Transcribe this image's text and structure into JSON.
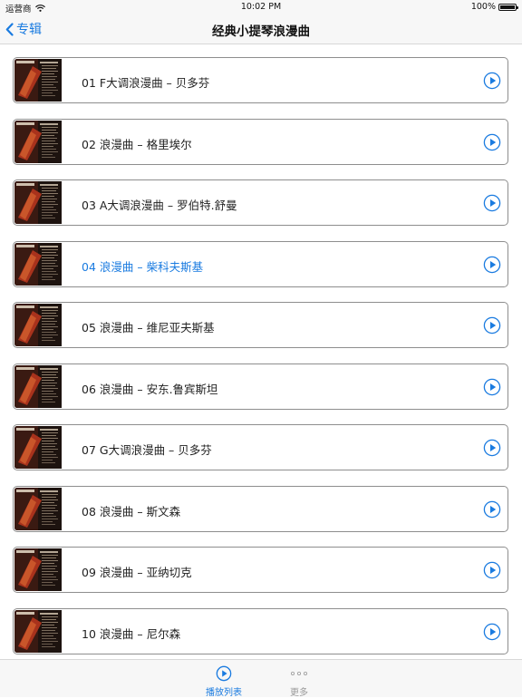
{
  "status_bar": {
    "carrier": "运营商",
    "time": "10:02 PM",
    "battery": "100%"
  },
  "nav": {
    "back_label": "专辑",
    "title": "经典小提琴浪漫曲"
  },
  "tracks": [
    {
      "label": "01 F大调浪漫曲  – 贝多芬",
      "active": false
    },
    {
      "label": "02 浪漫曲  – 格里埃尔",
      "active": false
    },
    {
      "label": "03 A大调浪漫曲  – 罗伯特.舒曼",
      "active": false
    },
    {
      "label": "04 浪漫曲  – 柴科夫斯基",
      "active": true
    },
    {
      "label": "05 浪漫曲  – 维尼亚夫斯基",
      "active": false
    },
    {
      "label": "06 浪漫曲  – 安东.鲁宾斯坦",
      "active": false
    },
    {
      "label": "07 G大调浪漫曲  – 贝多芬",
      "active": false
    },
    {
      "label": "08 浪漫曲  – 斯文森",
      "active": false
    },
    {
      "label": "09 浪漫曲  – 亚纳切克",
      "active": false
    },
    {
      "label": "10 浪漫曲  – 尼尔森",
      "active": false
    }
  ],
  "tab_bar": {
    "tabs": [
      {
        "label": "播放列表",
        "icon": "play-circle-icon",
        "selected": true
      },
      {
        "label": "更多",
        "icon": "more-dots-icon",
        "selected": false
      }
    ]
  },
  "colors": {
    "accent": "#1a7be0",
    "row_border": "#8e8e8e",
    "bar_bg": "#f7f7f7"
  }
}
